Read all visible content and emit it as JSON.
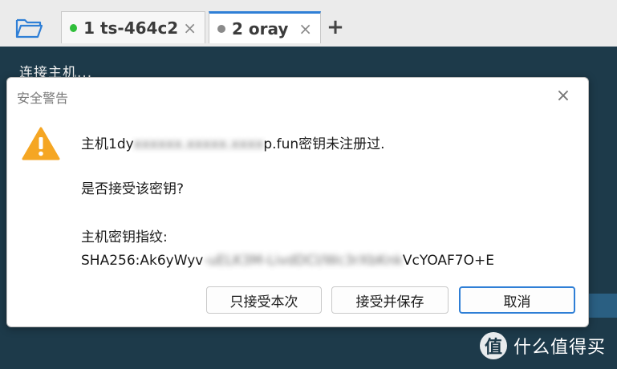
{
  "tabs": [
    {
      "label": "1 ts-464c2",
      "status_color": "#2fbe3a"
    },
    {
      "label": "2 oray",
      "status_color": "#8a8a8a"
    }
  ],
  "add_tab_label": "+",
  "close_symbol": "×",
  "terminal": {
    "line": "连接主机..."
  },
  "dialog": {
    "title": "安全警告",
    "msg_host_prefix": "主机1dy",
    "msg_host_blurred": "xxxxxx.xxxxx.xxxx",
    "msg_host_suffix": "p.fun密钥未注册过.",
    "question": "是否接受该密钥?",
    "fingerprint_label": "主机密钥指纹:",
    "fp_prefix": "SHA256:Ak6yWyv",
    "fp_blurred": "-uELK3M-LivdDCl/Wc3rXbKnk",
    "fp_suffix": "VcYOAF7O+E",
    "buttons": {
      "accept_once": "只接受本次",
      "accept_save": "接受并保存",
      "cancel": "取消"
    }
  },
  "watermark": {
    "symbol": "值",
    "text": "什么值得买"
  },
  "accent_color": "#2f7fd6"
}
